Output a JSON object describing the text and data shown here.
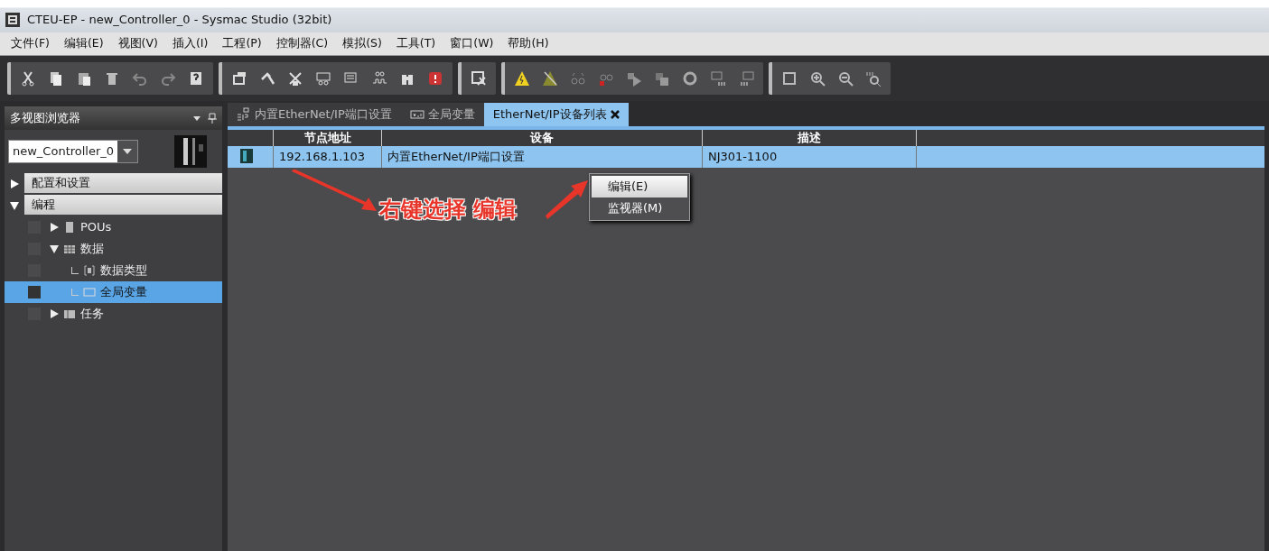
{
  "window": {
    "title": "CTEU-EP - new_Controller_0 - Sysmac Studio (32bit)"
  },
  "menu": [
    "文件(F)",
    "编辑(E)",
    "视图(V)",
    "插入(I)",
    "工程(P)",
    "控制器(C)",
    "模拟(S)",
    "工具(T)",
    "窗口(W)",
    "帮助(H)"
  ],
  "sidebar": {
    "title": "多视图浏览器",
    "controller": "new_Controller_0",
    "sections": [
      {
        "label": "配置和设置",
        "expanded": false
      },
      {
        "label": "编程",
        "expanded": true,
        "children": [
          {
            "label": "POUs",
            "kind": "pou",
            "expanded": false,
            "selected": false
          },
          {
            "label": "数据",
            "kind": "data",
            "expanded": true,
            "selected": false,
            "children": [
              {
                "label": "数据类型",
                "kind": "type",
                "selected": false
              },
              {
                "label": "全局变量",
                "kind": "var",
                "selected": true
              }
            ]
          },
          {
            "label": "任务",
            "kind": "task",
            "expanded": false,
            "selected": false
          }
        ]
      }
    ]
  },
  "tabs": [
    {
      "label": "内置EtherNet/IP端口设置",
      "kind": "eip",
      "selected": false
    },
    {
      "label": "全局变量",
      "kind": "var",
      "selected": false
    },
    {
      "label": "EtherNet/IP设备列表",
      "kind": "list",
      "selected": true
    }
  ],
  "table": {
    "columns": [
      "节点地址",
      "设备",
      "描述"
    ],
    "rows": [
      {
        "address": "192.168.1.103",
        "device": "内置EtherNet/IP端口设置",
        "description": "NJ301-1100",
        "selected": true
      }
    ]
  },
  "context_menu": [
    {
      "label": "编辑(E)",
      "selected": true
    },
    {
      "label": "监视器(M)",
      "selected": false
    }
  ],
  "annotation": "右键选择 编辑"
}
